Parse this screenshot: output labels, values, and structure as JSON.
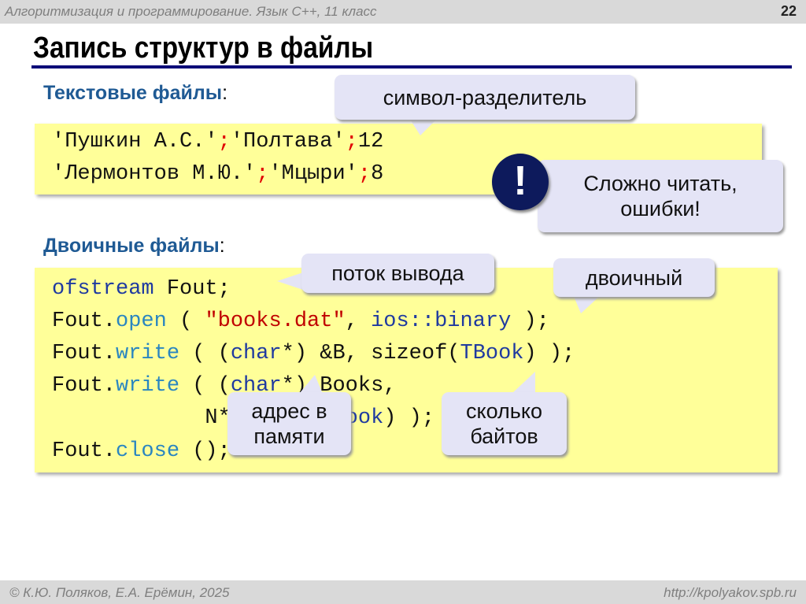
{
  "header": {
    "course": "Алгоритмизация и программирование. Язык С++, 11 класс",
    "slide_number": "22"
  },
  "title": "Запись структур в файлы",
  "text_section": {
    "heading": "Текстовые файлы",
    "colon": ":",
    "lines": [
      {
        "a": "'Пушкин А.С.'",
        "s1": ";",
        "b": "'Полтава'",
        "s2": ";",
        "c": "12"
      },
      {
        "a": "'Лермонтов М.Ю.'",
        "s1": ";",
        "b": "'Мцыри'",
        "s2": ";",
        "c": "8"
      }
    ]
  },
  "callouts": {
    "separator": "символ-разделитель",
    "warning_mark": "!",
    "warning_line1": "Сложно читать,",
    "warning_line2": "ошибки!",
    "stream": "поток вывода",
    "binary": "двоичный",
    "address_line1": "адрес в",
    "address_line2": "памяти",
    "bytes_line1": "сколько",
    "bytes_line2": "байтов"
  },
  "binary_section": {
    "heading": "Двоичные файлы",
    "colon": ":",
    "code": {
      "l1_kw": "ofstream",
      "l1_rest": " Fout;",
      "l2_obj": "Fout.",
      "l2_fn": "open",
      "l2_p": " ( ",
      "l2_str": "\"books.dat\"",
      "l2_c": ", ",
      "l2_kw": "ios::binary",
      "l2_end": " );",
      "l3_obj": "Fout.",
      "l3_fn": "write",
      "l3_p": " ( (",
      "l3_kw": "char",
      "l3_mid": "*) &B, sizeof(",
      "l3_t": "TBook",
      "l3_end": ") );",
      "l4_obj": "Fout.",
      "l4_fn": "write",
      "l4_p": " ( (",
      "l4_kw": "char",
      "l4_mid": "*) Books,",
      "l5_pre": "            N*sizeof(",
      "l5_t": "TBook",
      "l5_end": ") );",
      "l6_obj": "Fout.",
      "l6_fn": "close",
      "l6_end": " ();"
    }
  },
  "footer": {
    "authors": "© К.Ю. Поляков, Е.А. Ерёмин, 2025",
    "url": "http://kpolyakov.spb.ru"
  }
}
